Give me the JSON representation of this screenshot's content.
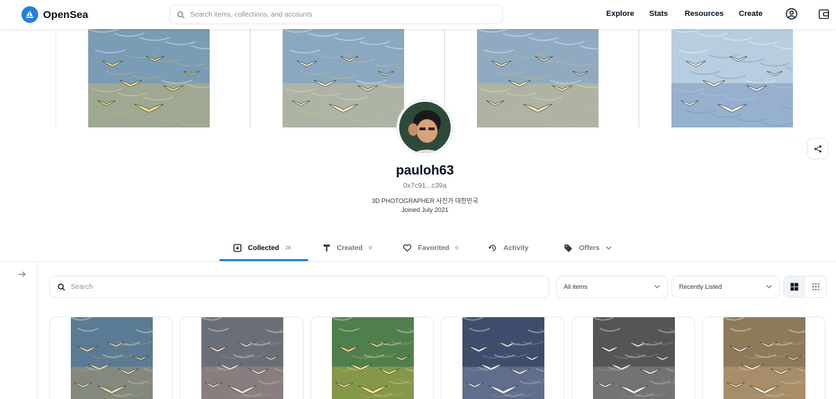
{
  "header": {
    "logo_text": "OpenSea",
    "search_placeholder": "Search items, collections, and accounts",
    "nav": [
      "Explore",
      "Stats",
      "Resources",
      "Create"
    ]
  },
  "profile": {
    "username": "pauloh63",
    "address": "0x7c91...c39a",
    "bio": "3D PHOTOGRAPHER 사진가 대한민국",
    "joined": "Joined July 2021"
  },
  "tabs": [
    {
      "label": "Collected",
      "count": "28",
      "icon": "collected-icon",
      "active": true
    },
    {
      "label": "Created",
      "count": "0",
      "icon": "brush-icon",
      "active": false
    },
    {
      "label": "Favorited",
      "count": "0",
      "icon": "heart-icon",
      "active": false
    },
    {
      "label": "Activity",
      "count": "",
      "icon": "history-icon",
      "active": false
    },
    {
      "label": "Offers",
      "count": "",
      "icon": "tag-icon",
      "active": false
    }
  ],
  "filters": {
    "search_placeholder": "Search",
    "items_select": "All items",
    "sort_select": "Recently Listed"
  },
  "colors": {
    "accent": "#2081e2",
    "text_primary": "#04111d",
    "text_secondary": "#707a83",
    "border": "#e5e8eb"
  },
  "banner_palettes": [
    {
      "bg": "#7a9cb4",
      "mid": "#c9b76a",
      "bird": "#f0e28a"
    },
    {
      "bg": "#8aa8c0",
      "mid": "#d6c084",
      "bird": "#f3e7c3"
    },
    {
      "bg": "#90aac2",
      "mid": "#d2be7e",
      "bird": "#f1e6c2"
    },
    {
      "bg": "#b8cde0",
      "mid": "#6d8fb8",
      "bird": "#f7f7f7"
    }
  ],
  "card_palettes": [
    {
      "bg": "#5a7b93",
      "mid": "#b79c68",
      "bird": "#eadbb4"
    },
    {
      "bg": "#6a6f77",
      "mid": "#b0908a",
      "bird": "#e8d9d2"
    },
    {
      "bg": "#4f7f4c",
      "mid": "#c8b548",
      "bird": "#f2e88e"
    },
    {
      "bg": "#3d4d6b",
      "mid": "#8b97b4",
      "bird": "#e3e8f2"
    },
    {
      "bg": "#555555",
      "mid": "#999999",
      "bird": "#e6e6e6"
    },
    {
      "bg": "#8d7a5a",
      "mid": "#c7a57a",
      "bird": "#efe2c8"
    }
  ]
}
